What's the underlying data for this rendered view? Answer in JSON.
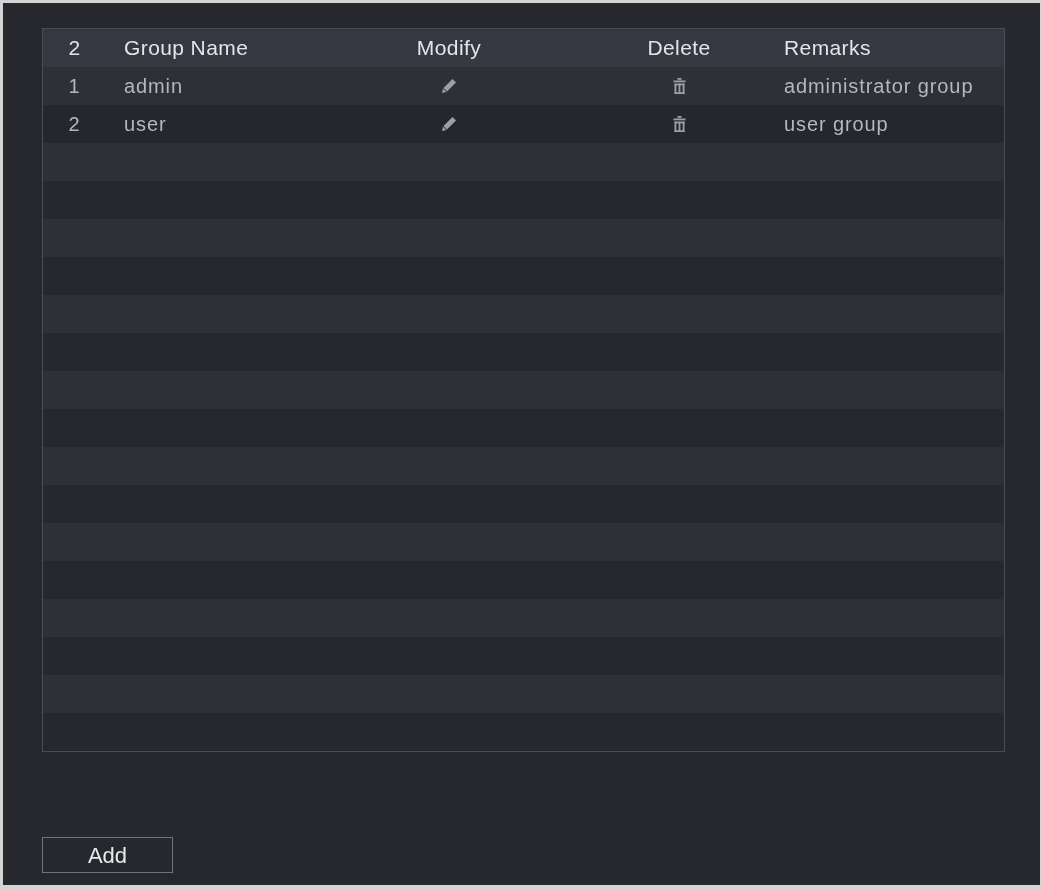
{
  "table": {
    "header": {
      "count": "2",
      "columns": [
        "Group Name",
        "Modify",
        "Delete",
        "Remarks"
      ]
    },
    "rows": [
      {
        "index": "1",
        "group_name": "admin",
        "remarks": "administrator group"
      },
      {
        "index": "2",
        "group_name": "user",
        "remarks": "user group"
      }
    ]
  },
  "buttons": [
    {
      "label": "Add"
    }
  ]
}
